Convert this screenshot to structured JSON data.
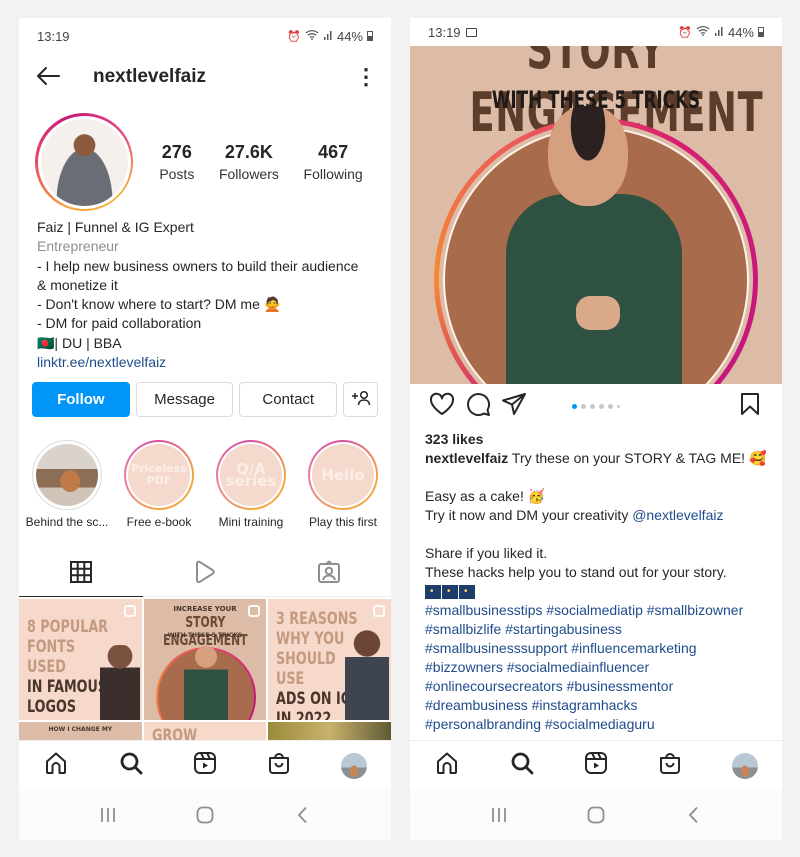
{
  "status_bar": {
    "time": "13:19",
    "battery": "44%"
  },
  "profile_screen": {
    "username": "nextlevelfaiz",
    "stats": [
      {
        "value": "276",
        "label": "Posts"
      },
      {
        "value": "27.6K",
        "label": "Followers"
      },
      {
        "value": "467",
        "label": "Following"
      }
    ],
    "bio": {
      "name": "Faiz | Funnel & IG Expert",
      "category": "Entrepreneur",
      "lines": [
        "- I help new business owners to build their audience",
        "& monetize it",
        "- Don't know where to start? DM me 🙅",
        "- DM for paid collaboration",
        "🇧🇩| DU | BBA"
      ],
      "link": "linktr.ee/nextlevelfaiz"
    },
    "buttons": {
      "follow": "Follow",
      "message": "Message",
      "contact": "Contact"
    },
    "highlights": [
      {
        "label": "Behind the sc...",
        "cover_text": ""
      },
      {
        "label": "Free e-book",
        "cover_text": "Priceless\nPDF"
      },
      {
        "label": "Mini training",
        "cover_text": "Q/A\nseries"
      },
      {
        "label": "Play this first",
        "cover_text": "Hello"
      }
    ],
    "grid_posts": [
      {
        "light": "8 POPULAR\nFONTS USED",
        "dark": "IN FAMOUS\nLOGOS"
      },
      {
        "top": "INCREASE YOUR",
        "title": "STORY ENGAGEMENT",
        "sub": "WITH THESE 5 TRICKS"
      },
      {
        "light": "3 REASONS\nWHY YOU\nSHOULD USE",
        "dark": "ADS ON IG\nIN 2022"
      },
      {
        "top": "HOW I CHANGE MY"
      },
      {
        "light": "GROW"
      },
      {}
    ]
  },
  "post_screen": {
    "image": {
      "title_cut": "STORY ENGAGEMENT",
      "subtitle": "WITH THESE 5 TRICKS"
    },
    "carousel": {
      "count": 6,
      "active_index": 0
    },
    "likes": "323 likes",
    "author": "nextlevelfaiz",
    "caption_first": "Try these on your STORY & TAG ME! 🥰",
    "caption_lines": [
      "Easy as a cake! 🥳",
      "Try it now and DM your creativity"
    ],
    "mention": "@nextlevelfaiz",
    "caption_lines_2": [
      "Share if you liked it.",
      "These hacks help you to stand out for your story."
    ],
    "hashtag_lines": [
      "#smallbusinesstips #socialmediatip #smallbizowner",
      "#smallbizlife #startingabusiness",
      "#smallbusinesssupport #influencemarketing",
      "#bizzowners #socialmediainfluencer",
      "#onlinecoursecreators #businessmentor",
      "#dreambusiness #instagramhacks",
      "#personalbranding #socialmediaguru"
    ]
  },
  "colors": {
    "accent_blue": "#0095f6",
    "link_blue": "#1f4c8c"
  }
}
